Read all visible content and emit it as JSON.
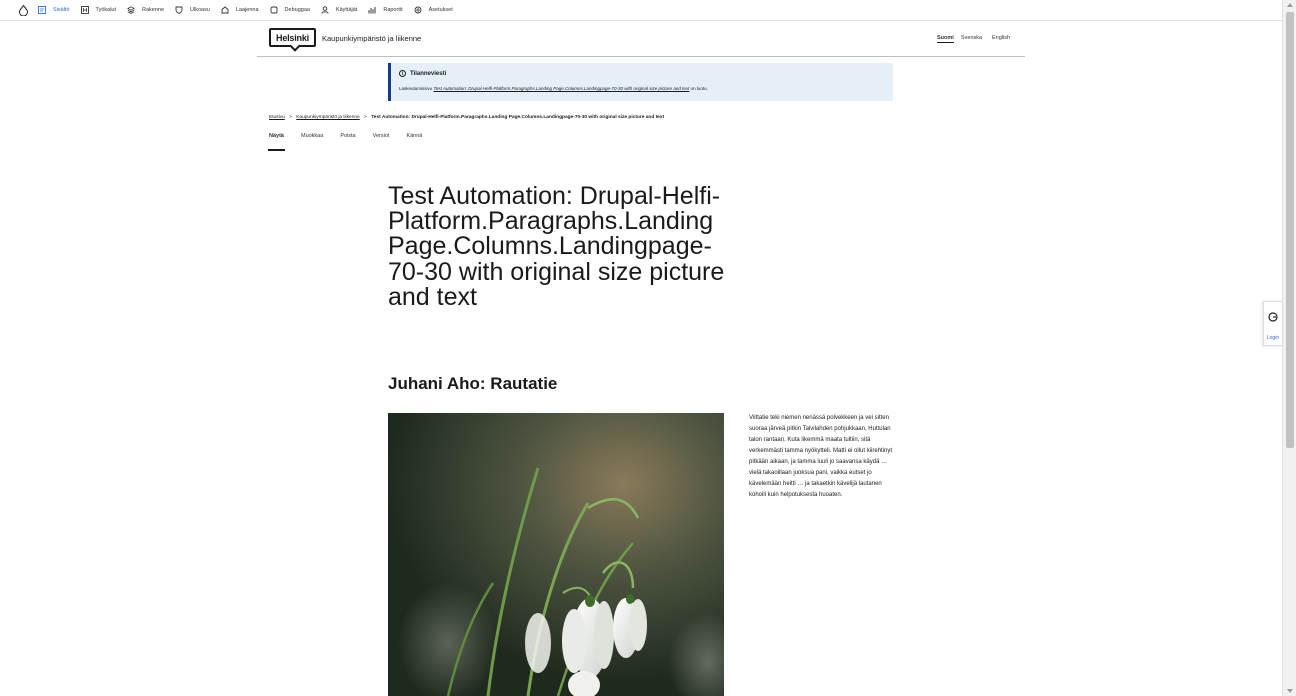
{
  "toolbar": {
    "items": [
      {
        "label": "Sisältö",
        "icon": "content-icon",
        "active": true
      },
      {
        "label": "Työkalut",
        "icon": "tools-icon"
      },
      {
        "label": "Rakenne",
        "icon": "structure-icon"
      },
      {
        "label": "Ulkoasu",
        "icon": "appearance-icon"
      },
      {
        "label": "Laajenna",
        "icon": "extend-icon"
      },
      {
        "label": "Debuggaa",
        "icon": "debug-icon"
      },
      {
        "label": "Käyttäjät",
        "icon": "people-icon"
      },
      {
        "label": "Raportit",
        "icon": "reports-icon"
      },
      {
        "label": "Asetukset",
        "icon": "config-icon"
      }
    ]
  },
  "header": {
    "logo_text": "Helsinki",
    "site_name": "Kaupunkiympäristö ja liikenne",
    "languages": [
      "Suomi",
      "Svenska",
      "English"
    ],
    "active_language": "Suomi"
  },
  "status": {
    "title": "Tilanneviesti",
    "text_prefix": "Laskeutumissivu ",
    "link_text": "Test Automation: Drupal-Helfi-Platform.Paragraphs.Landing Page.Columns.Landingpage-70-30 with original size picture and text",
    "text_suffix": " on luotu."
  },
  "breadcrumb": {
    "items": [
      "Etusivu",
      "Kaupunkiympäristö ja liikenne"
    ],
    "current": "Test Automation: Drupal-Helfi-Platform.Paragraphs.Landing Page.Columns.Landingpage-70-30 with original size picture and text",
    "separator": ">"
  },
  "tabs": [
    "Näytä",
    "Muokkaa",
    "Poista",
    "Versiot",
    "Kännä"
  ],
  "active_tab": "Näytä",
  "content": {
    "title": "Test Automation: Drupal-Helfi-Platform.Paragraphs.Landing Page.Columns.Landingpage-70-30 with original size picture and text",
    "subtitle": "Juhani Aho: Rautatie",
    "body": " Viittatie teki niemen nenässä polvekkeen ja vei sitten suoraa järveä pitkin Talvilahden pohjukkaan, Huttulan talon rantaan. Kuta likemmä maata tultiin, sitä verkemmästi tamma nyökytteli. Matti ei ollut kiirehtinyt pitkään aikaan, ja tamma luuli jo saavansa käydä … vielä takaoillaan juoksua pani, vaikka eutset jo kävelemään heitti … ja takaetkin kävelijä lautanen kohoili kuin helpotuksesta huoaten."
  },
  "side_widget": {
    "label": "Login"
  },
  "colors": {
    "accent": "#2c6ad6",
    "status_bg": "#e5eff8",
    "status_border": "#0f3a8a"
  }
}
